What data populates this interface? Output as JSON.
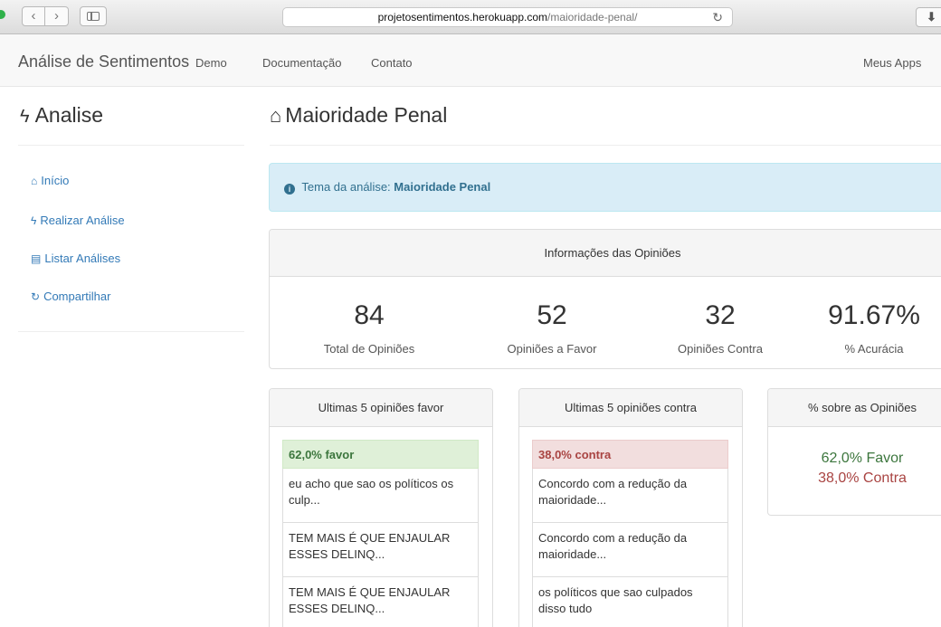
{
  "browser": {
    "url_host": "projetosentimentos.herokuapp.com",
    "url_path": "/maioridade-penal/",
    "back_glyph": "‹",
    "forward_glyph": "›",
    "reload_glyph": "↻",
    "download_glyph": "⬇"
  },
  "navbar": {
    "brand": "Análise de Sentimentos",
    "links": [
      "Demo",
      "Documentação",
      "Contato"
    ],
    "right_link": "Meus Apps"
  },
  "sidebar": {
    "title": "Analise",
    "items": [
      {
        "label": "Início",
        "icon": "home-icon"
      },
      {
        "label": "Realizar Análise",
        "icon": "bolt-icon"
      },
      {
        "label": "Listar Análises",
        "icon": "list-icon"
      },
      {
        "label": "Compartilhar",
        "icon": "share-icon"
      }
    ]
  },
  "main": {
    "title": "Maioridade Penal",
    "alert_prefix": "Tema da análise:",
    "alert_topic": "Maioridade Penal",
    "stats_heading": "Informações das Opiniões",
    "stats": [
      {
        "value": "84",
        "label": "Total de Opiniões"
      },
      {
        "value": "52",
        "label": "Opiniões a Favor"
      },
      {
        "value": "32",
        "label": "Opiniões Contra"
      },
      {
        "value": "91.67%",
        "label": "% Acurácia"
      }
    ],
    "favor_panel": {
      "heading": "Ultimas 5 opiniões favor",
      "header": "62,0% favor",
      "items": [
        "eu acho que sao os políticos os culp...",
        "TEM MAIS É QUE ENJAULAR ESSES DELINQ...",
        "TEM MAIS É QUE ENJAULAR ESSES DELINQ..."
      ]
    },
    "contra_panel": {
      "heading": "Ultimas 5 opiniões contra",
      "header": "38,0% contra",
      "items": [
        "Concordo com a redução da maioridade...",
        "Concordo com a redução da maioridade...",
        "os políticos que sao culpados disso tudo"
      ]
    },
    "percent_panel": {
      "heading": "% sobre as Opiniões",
      "favor": "62,0% Favor",
      "contra": "38,0% Contra"
    }
  },
  "colors": {
    "link": "#337ab7",
    "favor": "#3c763d",
    "contra": "#a94442",
    "info_bg": "#d9edf7"
  }
}
